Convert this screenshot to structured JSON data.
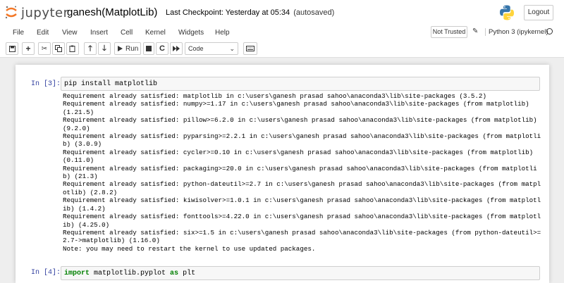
{
  "header": {
    "logo_text": "jupyter",
    "notebook_name": "ganesh(MatplotLib)",
    "checkpoint": "Last Checkpoint: Yesterday at 05:34",
    "autosave": "(autosaved)",
    "logout_label": "Logout"
  },
  "menu": {
    "items": [
      "File",
      "Edit",
      "View",
      "Insert",
      "Cell",
      "Kernel",
      "Widgets",
      "Help"
    ],
    "trust_label": "Not Trusted",
    "kernel_label": "Python 3 (ipykernel)"
  },
  "toolbar": {
    "run_label": "Run",
    "cell_type": "Code"
  },
  "cells": [
    {
      "prompt": "In [3]:",
      "code": "pip install matplotlib",
      "output": [
        "Requirement already satisfied: matplotlib in c:\\users\\ganesh prasad sahoo\\anaconda3\\lib\\site-packages (3.5.2)",
        "Requirement already satisfied: numpy>=1.17 in c:\\users\\ganesh prasad sahoo\\anaconda3\\lib\\site-packages (from matplotlib) (1.21.5)",
        "Requirement already satisfied: pillow>=6.2.0 in c:\\users\\ganesh prasad sahoo\\anaconda3\\lib\\site-packages (from matplotlib) (9.2.0)",
        "Requirement already satisfied: pyparsing>=2.2.1 in c:\\users\\ganesh prasad sahoo\\anaconda3\\lib\\site-packages (from matplotlib) (3.0.9)",
        "Requirement already satisfied: cycler>=0.10 in c:\\users\\ganesh prasad sahoo\\anaconda3\\lib\\site-packages (from matplotlib) (0.11.0)",
        "Requirement already satisfied: packaging>=20.0 in c:\\users\\ganesh prasad sahoo\\anaconda3\\lib\\site-packages (from matplotlib) (21.3)",
        "Requirement already satisfied: python-dateutil>=2.7 in c:\\users\\ganesh prasad sahoo\\anaconda3\\lib\\site-packages (from matplotlib) (2.8.2)",
        "Requirement already satisfied: kiwisolver>=1.0.1 in c:\\users\\ganesh prasad sahoo\\anaconda3\\lib\\site-packages (from matplotlib) (1.4.2)",
        "Requirement already satisfied: fonttools>=4.22.0 in c:\\users\\ganesh prasad sahoo\\anaconda3\\lib\\site-packages (from matplotlib) (4.25.0)",
        "Requirement already satisfied: six>=1.5 in c:\\users\\ganesh prasad sahoo\\anaconda3\\lib\\site-packages (from python-dateutil>=2.7->matplotlib) (1.16.0)",
        "Note: you may need to restart the kernel to use updated packages."
      ]
    },
    {
      "prompt": "In [4]:",
      "code_keyword_1": "import",
      "code_middle": " matplotlib.pyplot ",
      "code_keyword_2": "as",
      "code_end": " plt"
    }
  ]
}
